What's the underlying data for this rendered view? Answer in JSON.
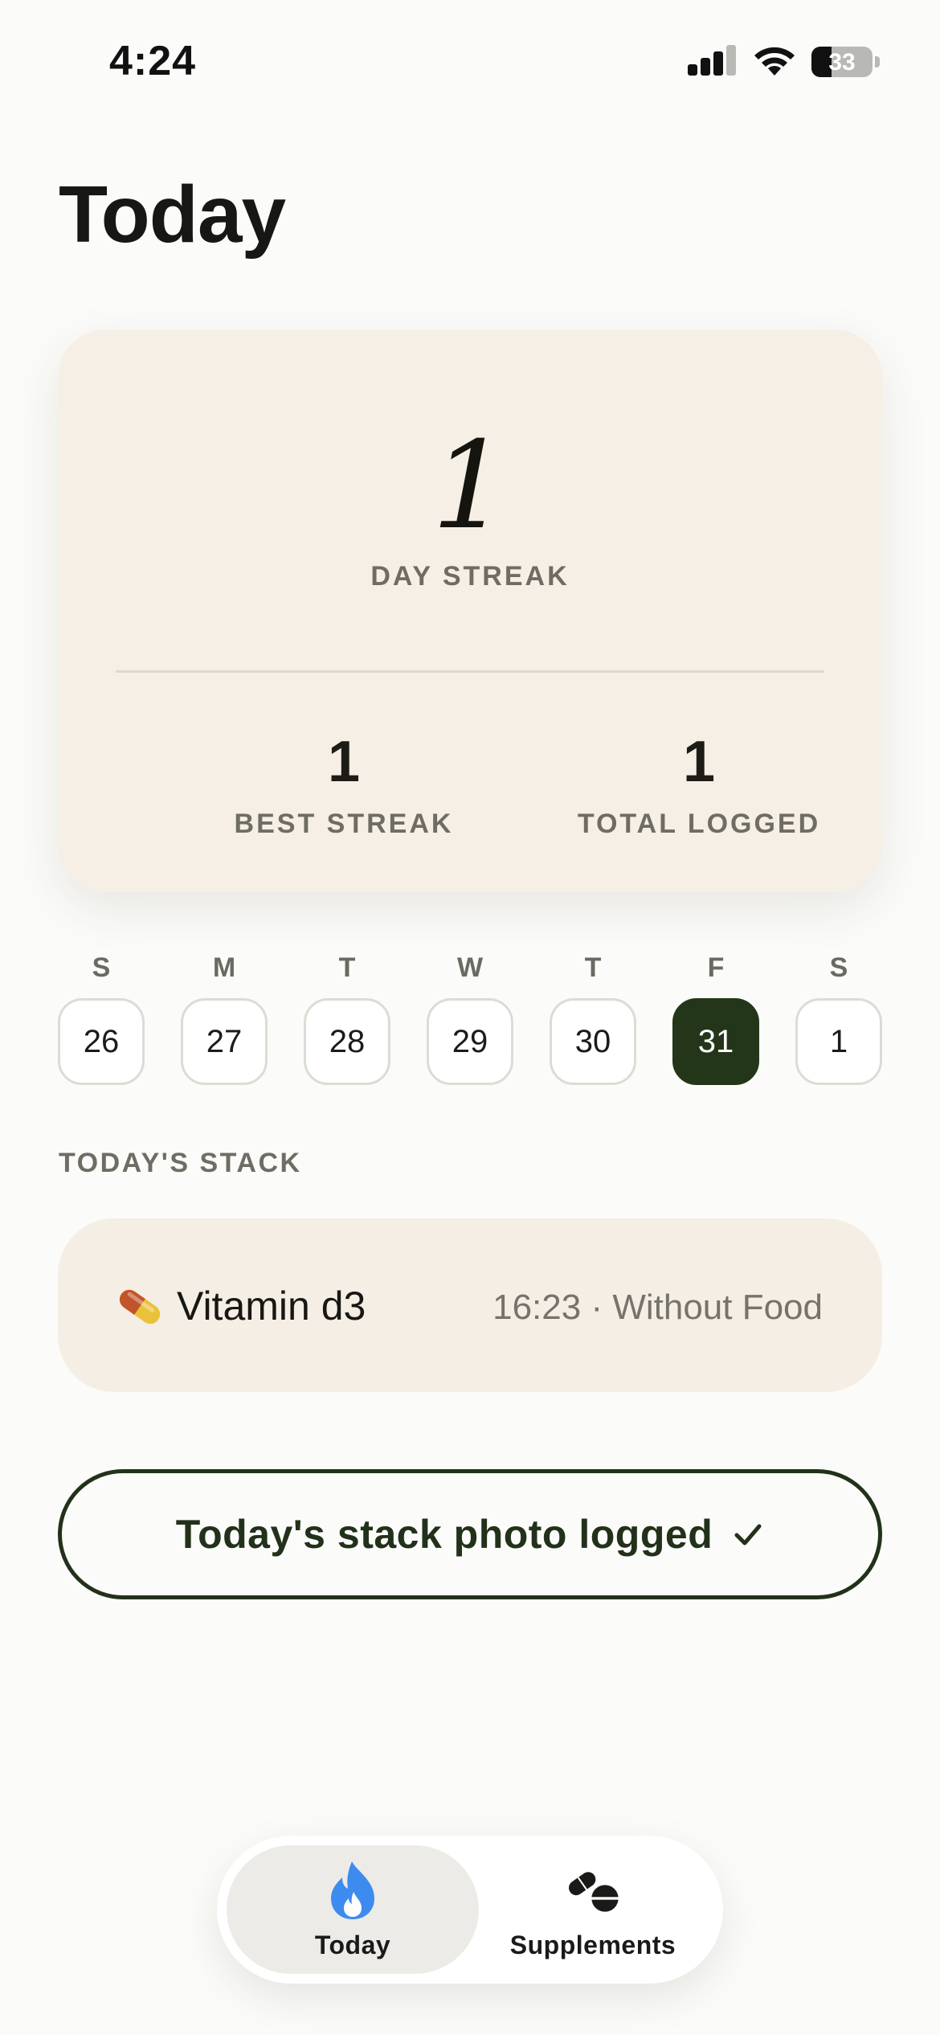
{
  "status_bar": {
    "time": "4:24",
    "battery_level": "33"
  },
  "page": {
    "title": "Today"
  },
  "streak_card": {
    "current_streak": "1",
    "current_streak_label": "DAY STREAK",
    "best_streak": "1",
    "best_streak_label": "BEST STREAK",
    "total_logged": "1",
    "total_logged_label": "TOTAL LOGGED"
  },
  "week": {
    "days": [
      {
        "letter": "S",
        "date": "26",
        "selected": false
      },
      {
        "letter": "M",
        "date": "27",
        "selected": false
      },
      {
        "letter": "T",
        "date": "28",
        "selected": false
      },
      {
        "letter": "W",
        "date": "29",
        "selected": false
      },
      {
        "letter": "T",
        "date": "30",
        "selected": false
      },
      {
        "letter": "F",
        "date": "31",
        "selected": true
      },
      {
        "letter": "S",
        "date": "1",
        "selected": false
      }
    ]
  },
  "stack": {
    "section_label": "TODAY'S STACK",
    "items": [
      {
        "icon": "pill-icon",
        "name": "Vitamin d3",
        "meta": "16:23 · Without Food"
      }
    ]
  },
  "photo_button": {
    "label": "Today's stack photo logged"
  },
  "tab_bar": {
    "tabs": [
      {
        "label": "Today",
        "icon": "flame-icon",
        "active": true
      },
      {
        "label": "Supplements",
        "icon": "pills-icon",
        "active": false
      }
    ]
  },
  "colors": {
    "accent_dark_green": "#233619",
    "card_beige": "#f5efe6",
    "flame_blue": "#3d8bef",
    "background": "#fbfbf9"
  }
}
